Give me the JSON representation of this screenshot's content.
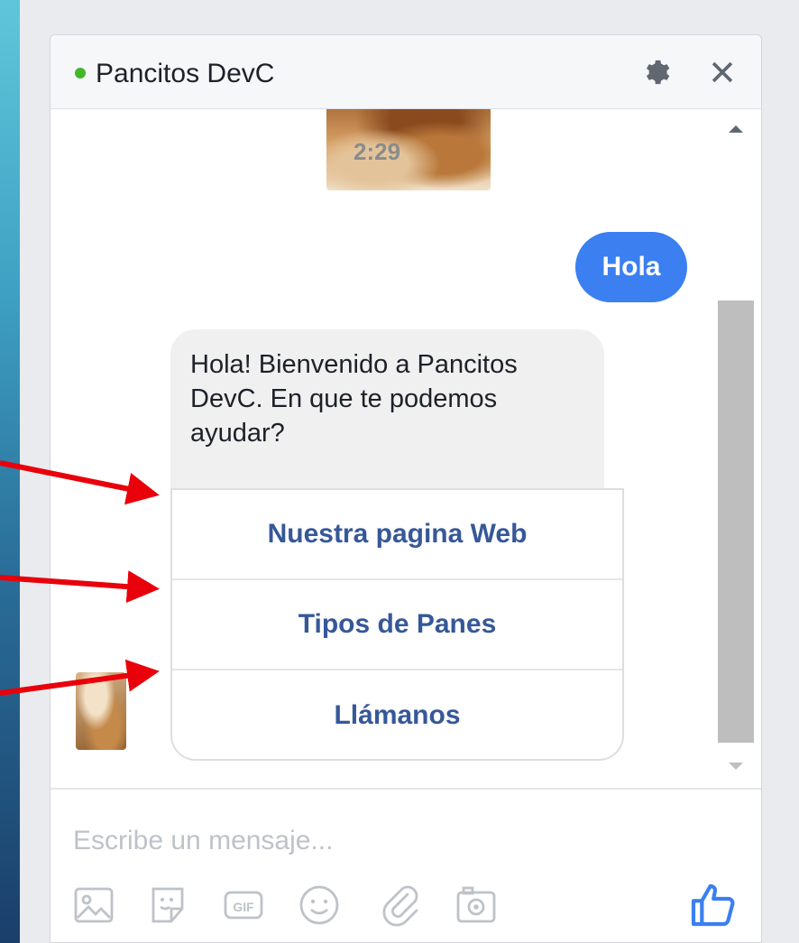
{
  "header": {
    "title": "Pancitos DevC",
    "status": "online"
  },
  "messages": {
    "image_timestamp": "2:29",
    "user_message": "Hola",
    "bot_message": "Hola! Bienvenido a Pancitos DevC. En que te podemos ayudar?",
    "quick_replies": [
      "Nuestra pagina Web",
      "Tipos de Panes",
      "Llámanos"
    ]
  },
  "composer": {
    "placeholder": "Escribe un mensaje...",
    "tools": [
      "image-icon",
      "sticker-icon",
      "gif-icon",
      "emoji-icon",
      "attachment-icon",
      "camera-icon"
    ],
    "send_icon": "thumbs-up-icon"
  },
  "colors": {
    "accent": "#3b7ff1",
    "link": "#365899",
    "online": "#42b72a",
    "annotation_arrow": "#e8000b"
  }
}
